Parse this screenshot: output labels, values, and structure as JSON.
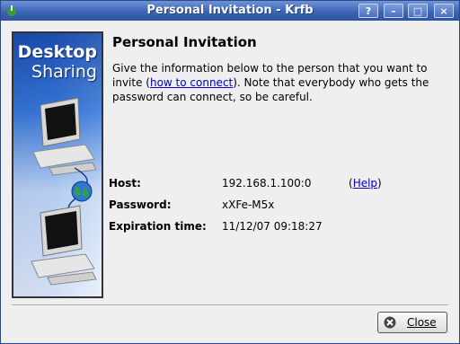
{
  "window": {
    "title": "Personal Invitation - Krfb",
    "buttons": {
      "help": "?",
      "minimize": "–",
      "maximize": "□",
      "close": "×"
    }
  },
  "banner": {
    "line1": "Desktop",
    "line2": "Sharing"
  },
  "heading": "Personal Invitation",
  "description": {
    "before_link": "Give the information below to the person that you want to invite (",
    "link": "how to connect",
    "after_link": "). Note that everybody who gets the password can connect, so be careful."
  },
  "fields": {
    "host_label": "Host:",
    "host_value": "192.168.1.100:0",
    "help_open": "(",
    "help_link": "Help",
    "help_close": ")",
    "password_label": "Password:",
    "password_value": "xXFe-M5x",
    "expiration_label": "Expiration time:",
    "expiration_value": "11/12/07 09:18:27"
  },
  "footer": {
    "close_label": "Close"
  }
}
